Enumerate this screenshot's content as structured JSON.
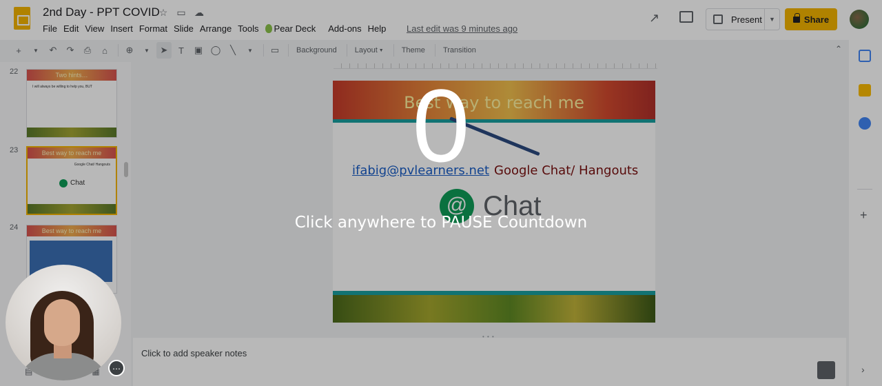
{
  "header": {
    "doc_title": "2nd Day - PPT COVID",
    "menu": [
      "File",
      "Edit",
      "View",
      "Insert",
      "Format",
      "Slide",
      "Arrange",
      "Tools",
      "Pear Deck",
      "Add-ons",
      "Help"
    ],
    "last_edit": "Last edit was 9 minutes ago",
    "present_label": "Present",
    "share_label": "Share"
  },
  "toolbar": {
    "background_label": "Background",
    "layout_label": "Layout",
    "theme_label": "Theme",
    "transition_label": "Transition"
  },
  "filmstrip": {
    "slides": [
      {
        "number": "22",
        "title": "Two hints…",
        "body": "I will always be willing to help you, BUT"
      },
      {
        "number": "23",
        "title": "Best way to reach me",
        "body": "Google Chat/ Hangouts",
        "chat": "Chat"
      },
      {
        "number": "24",
        "title": "Best way to reach me"
      }
    ]
  },
  "slide": {
    "title": "Best way to reach me",
    "email": "ifabig@pvlearners.net",
    "chat_text": "Google Chat/ Hangouts",
    "chat_word": "Chat"
  },
  "notes": {
    "placeholder": "Click to add speaker notes"
  },
  "overlay": {
    "countdown": "0",
    "message": "Click anywhere to PAUSE Countdown"
  },
  "colors": {
    "brand_yellow": "#f4b400",
    "chat_green": "#0f9d58"
  }
}
